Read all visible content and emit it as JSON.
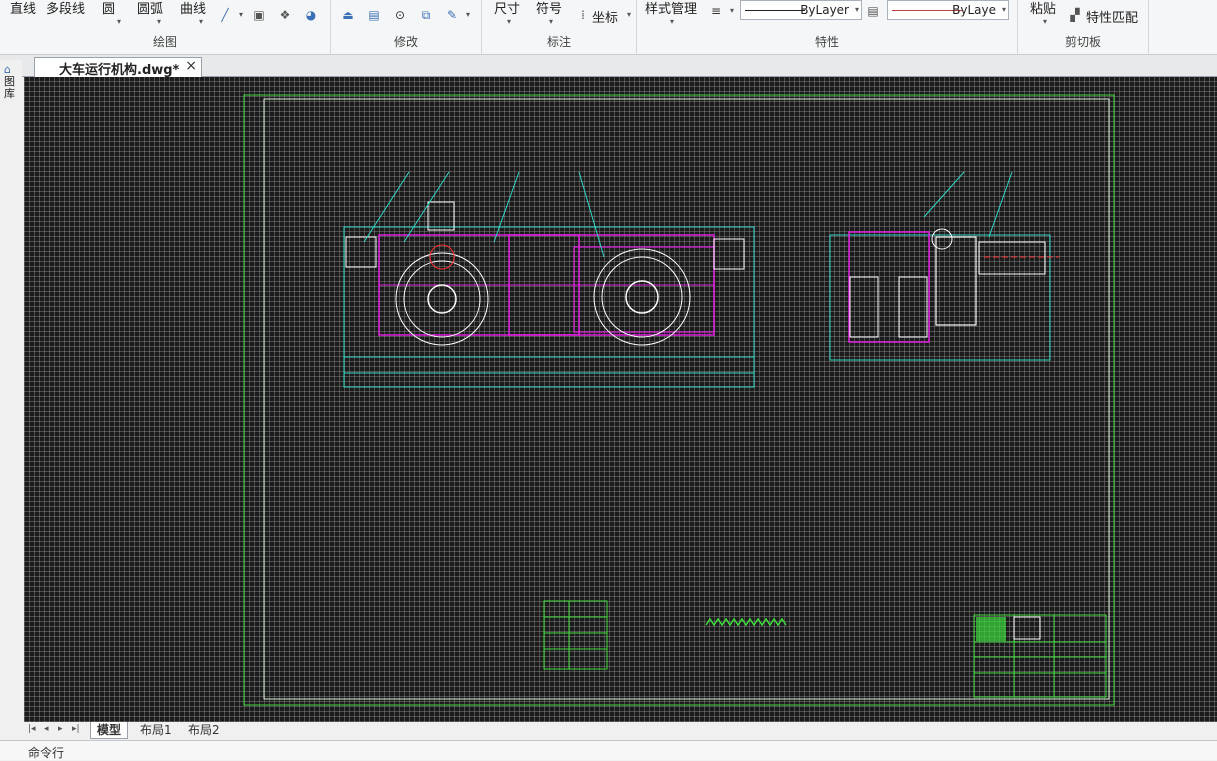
{
  "ribbon": {
    "draw": {
      "title": "绘图",
      "line": "直线",
      "polyline": "多段线",
      "circle": "圆",
      "arc": "圆弧",
      "curve": "曲线"
    },
    "modify": {
      "title": "修改"
    },
    "annotate": {
      "title": "标注",
      "dimension": "尺寸",
      "symbol": "符号",
      "coordinate": "坐标"
    },
    "properties": {
      "title": "特性",
      "style_manager": "样式管理",
      "linetype": "ByLayer",
      "color": "ByLaye"
    },
    "clipboard": {
      "title": "剪切板",
      "paste": "粘贴",
      "match_properties": "特性匹配"
    }
  },
  "document_tab": {
    "name": "大车运行机构.dwg*",
    "close": "×"
  },
  "left_palette": {
    "label": "图库"
  },
  "layout_tabs": [
    {
      "label": "模型",
      "active": true
    },
    {
      "label": "布局1",
      "active": false
    },
    {
      "label": "布局2",
      "active": false
    }
  ],
  "command_line": {
    "label": "命令行"
  },
  "colors": {
    "canvas_bg": "#1b1b1b",
    "frame_green": "#3cdc3c",
    "magenta": "#e020e0",
    "cyan": "#30d8c8",
    "white": "#ffffff",
    "red": "#ff3030"
  }
}
